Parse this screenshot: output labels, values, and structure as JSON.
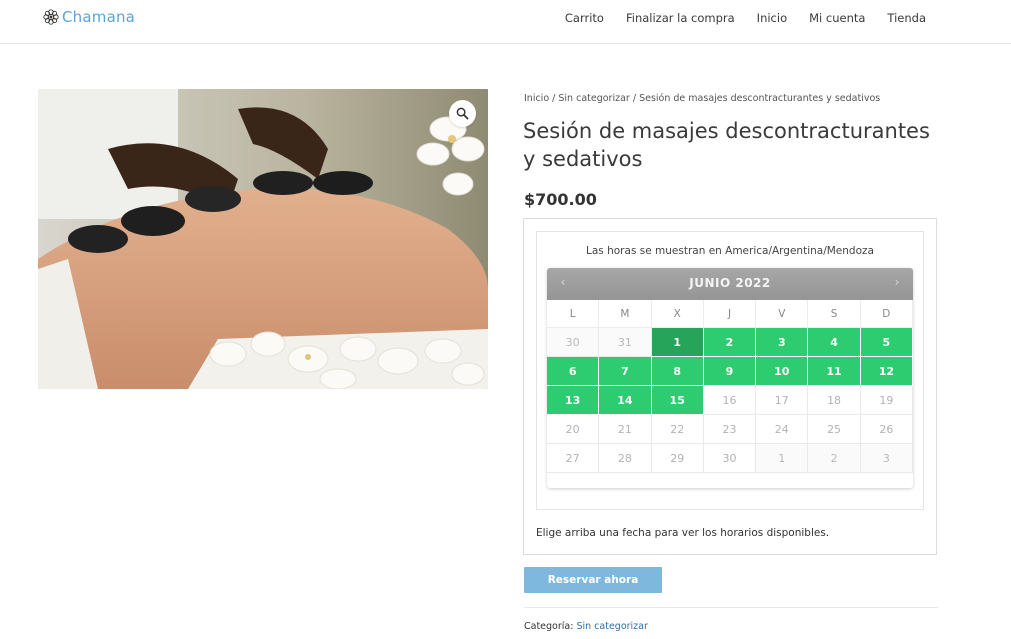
{
  "header": {
    "logo_text": "Chamana",
    "nav": [
      "Carrito",
      "Finalizar la compra",
      "Inicio",
      "Mi cuenta",
      "Tienda"
    ]
  },
  "breadcrumb": {
    "items": [
      "Inicio",
      "Sin categorizar",
      "Sesión de masajes descontracturantes y sedativos"
    ],
    "separator": " / "
  },
  "product": {
    "title": "Sesión de masajes descontracturantes y sedativos",
    "price": "$700.00",
    "image_alt": "massage-photo"
  },
  "booking": {
    "timezone_text": "Las horas se muestran en America/Argentina/Mendoza",
    "calendar": {
      "month_title": "JUNIO 2022",
      "prev": "‹",
      "next": "›",
      "weekdays": [
        "L",
        "M",
        "X",
        "J",
        "V",
        "S",
        "D"
      ],
      "days": [
        {
          "n": "30",
          "state": "other"
        },
        {
          "n": "31",
          "state": "other"
        },
        {
          "n": "1",
          "state": "selected"
        },
        {
          "n": "2",
          "state": "avail"
        },
        {
          "n": "3",
          "state": "avail"
        },
        {
          "n": "4",
          "state": "avail"
        },
        {
          "n": "5",
          "state": "avail"
        },
        {
          "n": "6",
          "state": "avail"
        },
        {
          "n": "7",
          "state": "avail"
        },
        {
          "n": "8",
          "state": "avail"
        },
        {
          "n": "9",
          "state": "avail"
        },
        {
          "n": "10",
          "state": "avail"
        },
        {
          "n": "11",
          "state": "avail"
        },
        {
          "n": "12",
          "state": "avail"
        },
        {
          "n": "13",
          "state": "avail"
        },
        {
          "n": "14",
          "state": "avail"
        },
        {
          "n": "15",
          "state": "avail"
        },
        {
          "n": "16",
          "state": "disabled"
        },
        {
          "n": "17",
          "state": "disabled"
        },
        {
          "n": "18",
          "state": "disabled"
        },
        {
          "n": "19",
          "state": "disabled"
        },
        {
          "n": "20",
          "state": "disabled"
        },
        {
          "n": "21",
          "state": "disabled"
        },
        {
          "n": "22",
          "state": "disabled"
        },
        {
          "n": "23",
          "state": "disabled"
        },
        {
          "n": "24",
          "state": "disabled"
        },
        {
          "n": "25",
          "state": "disabled"
        },
        {
          "n": "26",
          "state": "disabled"
        },
        {
          "n": "27",
          "state": "disabled"
        },
        {
          "n": "28",
          "state": "disabled"
        },
        {
          "n": "29",
          "state": "disabled"
        },
        {
          "n": "30",
          "state": "disabled"
        },
        {
          "n": "1",
          "state": "other"
        },
        {
          "n": "2",
          "state": "other"
        },
        {
          "n": "3",
          "state": "other"
        }
      ]
    },
    "hint": "Elige arriba una fecha para ver los horarios disponibles.",
    "button_label": "Reservar ahora"
  },
  "meta": {
    "category_label": "Categoría:",
    "category_value": "Sin categorizar"
  },
  "colors": {
    "available": "#2ecc71",
    "selected": "#26a45a",
    "button": "#7fb8dd",
    "logo": "#5aa5d6"
  }
}
